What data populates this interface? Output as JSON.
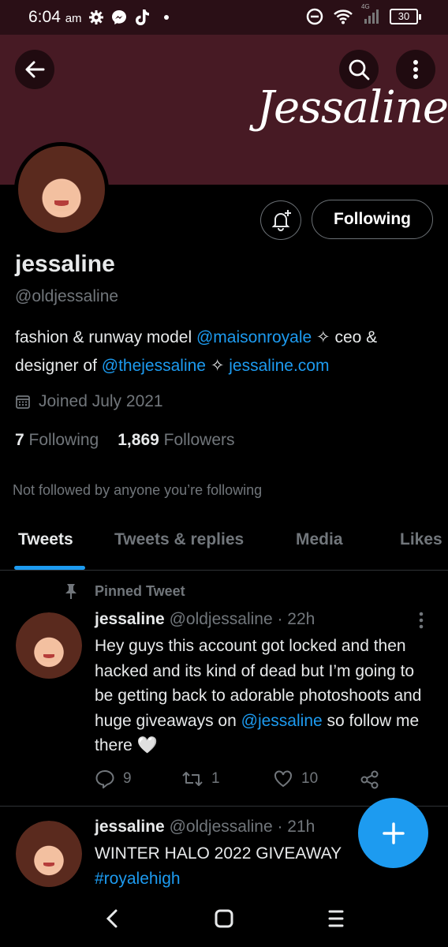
{
  "status_bar": {
    "time": "6:04",
    "ampm": "am",
    "network": "4G",
    "battery": "30"
  },
  "banner": {
    "script_text": "Jessaline"
  },
  "profile": {
    "display_name": "jessaline",
    "handle": "@oldjessaline",
    "following_button": "Following",
    "bio": {
      "part1": "fashion & runway model ",
      "mention1": "@maisonroyale",
      "part2": " ✧ ceo & designer of ",
      "mention2": "@thejessaline",
      "part3": " ✧ ",
      "url": "jessaline.com"
    },
    "joined": "Joined July 2021",
    "following_count": "7",
    "following_label": "Following",
    "followers_count": "1,869",
    "followers_label": "Followers",
    "not_followed": "Not followed by anyone you’re following"
  },
  "tabs": [
    "Tweets",
    "Tweets & replies",
    "Media",
    "Likes"
  ],
  "tweets": [
    {
      "pinned_label": "Pinned Tweet",
      "name": "jessaline",
      "handle_time": "@oldjessaline · 22h",
      "text": "Hey guys this account got locked and then hacked and its kind of dead but I’m going to be getting back to adorable photoshoots and huge giveaways on ",
      "mention": "@jessaline",
      "text_end": " so follow me there 🤍",
      "replies": "9",
      "retweets": "1",
      "likes": "10"
    },
    {
      "name": "jessaline",
      "handle_time": "@oldjessaline · 21h",
      "text": "WINTER HALO 2022 GIVEAWAY",
      "hashtag": "#royalehigh"
    }
  ],
  "colors": {
    "accent": "#1d9bf0",
    "banner": "#471a24",
    "background": "#000000",
    "muted": "#71767b"
  }
}
